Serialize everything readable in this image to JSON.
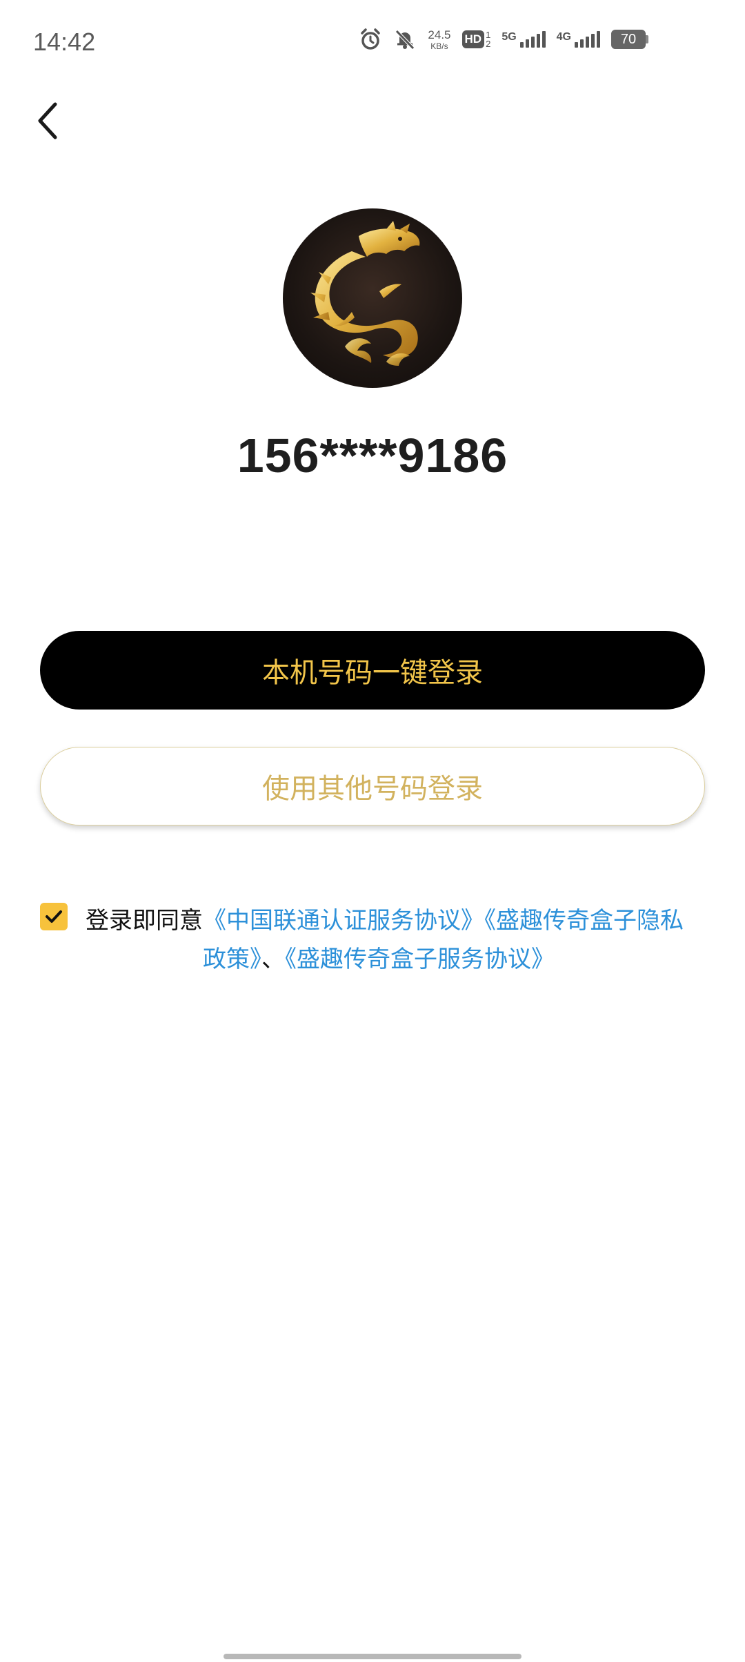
{
  "status_bar": {
    "time": "14:42",
    "net_speed_value": "24.5",
    "net_speed_unit": "KB/s",
    "hd_label": "HD",
    "hd_sub_top": "1",
    "hd_sub_bottom": "2",
    "signal1_label": "5G",
    "signal2_label": "4G",
    "battery": "70",
    "icons": [
      "alarm-icon",
      "mute-icon",
      "hd-icon",
      "signal-5g-icon",
      "signal-4g-icon",
      "battery-icon"
    ]
  },
  "header": {
    "back_icon": "chevron-left-icon"
  },
  "profile": {
    "logo_icon": "dragon-logo",
    "phone_masked": "156****9186"
  },
  "actions": {
    "one_click_login": "本机号码一键登录",
    "other_number_login": "使用其他号码登录"
  },
  "agreement": {
    "checked": true,
    "prefix": "登录即同意",
    "link1": "《中国联通认证服务协议》",
    "link2_part1": "《盛趣传奇盒子隐私",
    "link2_part2": "政策》",
    "separator": "、",
    "link3": "《盛趣传奇盒子服务协议》"
  },
  "colors": {
    "primary_button_bg": "#000000",
    "primary_button_text": "#f2c54a",
    "secondary_button_text": "#d2b25e",
    "link": "#2c90d9",
    "checkbox": "#f7c23c"
  }
}
